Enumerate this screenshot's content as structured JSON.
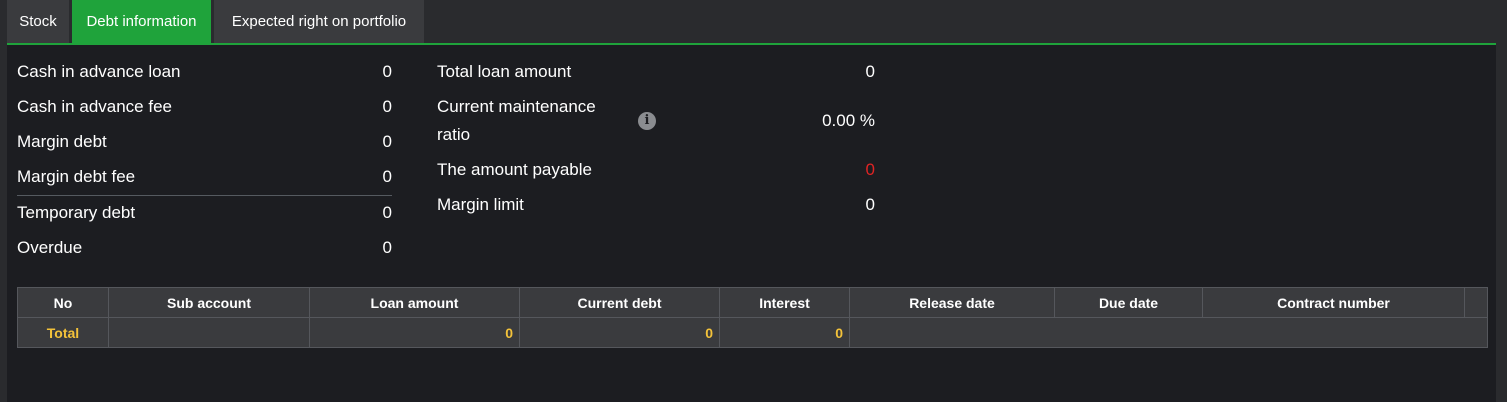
{
  "tabs": [
    {
      "label": "Stock",
      "active": false
    },
    {
      "label": "Debt information",
      "active": true
    },
    {
      "label": "Expected right on portfolio",
      "active": false
    }
  ],
  "left_summary": [
    {
      "label": "Cash in advance loan",
      "value": "0"
    },
    {
      "label": "Cash in advance fee",
      "value": "0"
    },
    {
      "label": "Margin debt",
      "value": "0"
    },
    {
      "label": "Margin debt fee",
      "value": "0"
    },
    {
      "label": "Temporary debt",
      "value": "0"
    },
    {
      "label": "Overdue",
      "value": "0"
    }
  ],
  "right_summary": {
    "total_loan_amount": {
      "label": "Total loan amount",
      "value": "0"
    },
    "maintenance_ratio": {
      "label_line1": "Current maintenance",
      "label_line2": "ratio",
      "value": "0.00 %"
    },
    "amount_payable": {
      "label": "The amount payable",
      "value": "0",
      "color": "#e02424"
    },
    "margin_limit": {
      "label": "Margin limit",
      "value": "0"
    }
  },
  "info_icon": "i",
  "table": {
    "headers": [
      "No",
      "Sub account",
      "Loan amount",
      "Current debt",
      "Interest",
      "Release date",
      "Due date",
      "Contract number"
    ],
    "total_row": {
      "label": "Total",
      "loan_amount": "0",
      "current_debt": "0",
      "interest": "0"
    }
  },
  "colors": {
    "accent": "#1fa33b",
    "total_text": "#f3c23a",
    "negative": "#e02424"
  }
}
